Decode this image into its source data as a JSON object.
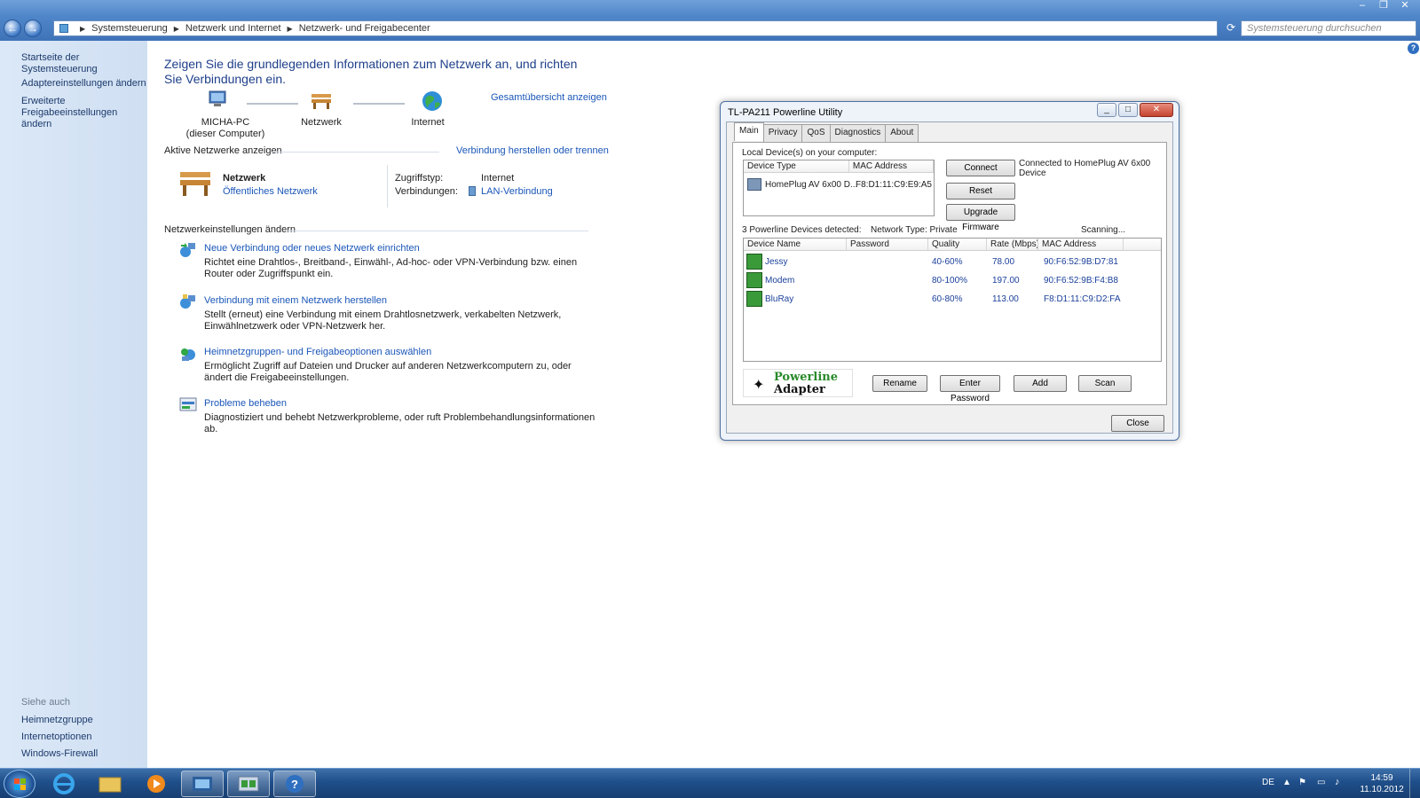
{
  "window": {
    "controls": [
      "–",
      "❐",
      "✕"
    ],
    "nav_back": "←",
    "nav_forward": "→",
    "breadcrumb": [
      "Systemsteuerung",
      "Netzwerk und Internet",
      "Netzwerk- und Freigabecenter"
    ],
    "search_placeholder": "Systemsteuerung durchsuchen"
  },
  "sidebar": {
    "home": "Startseite der Systemsteuerung",
    "adapter": "Adaptereinstellungen ändern",
    "advanced_line1": "Erweiterte",
    "advanced_line2": "Freigabeeinstellungen ändern",
    "see_also": "Siehe auch",
    "homegroup": "Heimnetzgruppe",
    "internet_options": "Internetoptionen",
    "firewall": "Windows-Firewall"
  },
  "main": {
    "heading": "Zeigen Sie die grundlegenden Informationen zum Netzwerk an, und richten Sie Verbindungen ein.",
    "overview_link": "Gesamtübersicht anzeigen",
    "map": {
      "pc_name": "MICHA-PC",
      "pc_sub": "(dieser Computer)",
      "network": "Netzwerk",
      "internet": "Internet"
    },
    "active_networks_title": "Aktive Netzwerke anzeigen",
    "connect_link": "Verbindung herstellen oder trennen",
    "active": {
      "name": "Netzwerk",
      "type": "Öffentliches Netzwerk",
      "access_label": "Zugriffstyp:",
      "access_value": "Internet",
      "connections_label": "Verbindungen:",
      "connections_value": "LAN-Verbindung"
    },
    "settings_title": "Netzwerkeinstellungen ändern",
    "tasks": [
      {
        "title": "Neue Verbindung oder neues Netzwerk einrichten",
        "desc": "Richtet eine Drahtlos-, Breitband-, Einwähl-, Ad-hoc- oder VPN-Verbindung bzw. einen Router oder Zugriffspunkt ein."
      },
      {
        "title": "Verbindung mit einem Netzwerk herstellen",
        "desc": "Stellt (erneut) eine Verbindung mit einem Drahtlosnetzwerk, verkabelten Netzwerk, Einwählnetzwerk oder VPN-Netzwerk her."
      },
      {
        "title": "Heimnetzgruppen- und Freigabeoptionen auswählen",
        "desc": "Ermöglicht Zugriff auf Dateien und Drucker auf anderen Netzwerkcomputern zu, oder ändert die Freigabeeinstellungen."
      },
      {
        "title": "Probleme beheben",
        "desc": "Diagnostiziert und behebt Netzwerkprobleme, oder ruft Problembehandlungsinformationen ab."
      }
    ]
  },
  "dialog": {
    "title": "TL-PA211 Powerline Utility",
    "tabs": [
      "Main",
      "Privacy",
      "QoS",
      "Diagnostics",
      "About"
    ],
    "local_label": "Local Device(s) on your computer:",
    "local_headers": [
      "Device Type",
      "MAC Address"
    ],
    "local_device": {
      "type": "HomePlug AV 6x00 D...",
      "mac": "F8:D1:11:C9:E9:A5"
    },
    "buttons": {
      "connect": "Connect",
      "reset": "Reset",
      "upgrade": "Upgrade Firmware",
      "rename": "Rename",
      "enter_password": "Enter Password",
      "add": "Add",
      "scan": "Scan",
      "close": "Close"
    },
    "status_line1": "Connected to HomePlug AV 6x00",
    "status_line2": "Device",
    "detected": "3 Powerline Devices detected:",
    "network_type": "Network Type: Private",
    "scanning": "Scanning...",
    "remote_headers": [
      "Device Name",
      "Password",
      "Quality",
      "Rate (Mbps)",
      "MAC Address"
    ],
    "remote_devices": [
      {
        "name": "Jessy",
        "password": "",
        "quality": "40-60%",
        "rate": "78.00",
        "mac": "90:F6:52:9B:D7:81"
      },
      {
        "name": "Modem",
        "password": "",
        "quality": "80-100%",
        "rate": "197.00",
        "mac": "90:F6:52:9B:F4:B8"
      },
      {
        "name": "BluRay",
        "password": "",
        "quality": "60-80%",
        "rate": "113.00",
        "mac": "F8:D1:11:C9:D2:FA"
      }
    ],
    "logo_line1": "Powerline",
    "logo_line2": "Adapter"
  },
  "taskbar": {
    "language": "DE",
    "time": "14:59",
    "date": "11.10.2012"
  },
  "help_icon": "?"
}
